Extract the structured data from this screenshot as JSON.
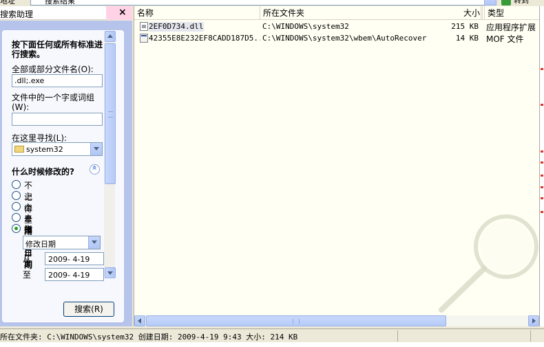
{
  "topbar": {
    "address_label": "地址",
    "address_value": "搜索结果",
    "go_label": "转到"
  },
  "left": {
    "pane_title": "搜索助理",
    "close_glyph": "×",
    "heading": "按下面任何或所有标准进行搜索。",
    "filename_label": "全部或部分文件名(O):",
    "filename_value": ".dll;.exe",
    "text_label": "文件中的一个字或词组(W):",
    "text_value": "",
    "lookin_label": "在这里寻找(L):",
    "lookin_value": "system32",
    "when_title": "什么时候修改的?",
    "radio_options": [
      {
        "label": "不记得",
        "checked": false
      },
      {
        "label": "上个星期内",
        "checked": false
      },
      {
        "label": "上个月",
        "checked": false
      },
      {
        "label": "去年一年内",
        "checked": false
      },
      {
        "label": "指定日期",
        "checked": true
      }
    ],
    "date_type_value": "修改日期",
    "from_label": "从",
    "from_value": "2009- 4-19",
    "to_label": "至",
    "to_value": "2009- 4-19",
    "search_button": "搜索(R)"
  },
  "results": {
    "columns": [
      "名称",
      "所在文件夹",
      "大小",
      "类型"
    ],
    "rows": [
      {
        "name": "2EF0D734.dll",
        "folder": "C:\\WINDOWS\\system32",
        "size": "215 KB",
        "type": "应用程序扩展",
        "icon": "dll-file-icon"
      },
      {
        "name": "42355E8E232EF8CADD187D5...",
        "folder": "C:\\WINDOWS\\system32\\wbem\\AutoRecover",
        "size": "14 KB",
        "type": "MOF 文件",
        "icon": "mof-file-icon"
      }
    ]
  },
  "status": {
    "text": "所在文件夹: C:\\WINDOWS\\system32 创建日期: 2009-4-19 9:43 大小: 214 KB"
  },
  "colors": {
    "pane_blue": "#b6c4ec",
    "results_bg": "#fffff3",
    "selected_row": "#e4e6ee",
    "radio_checked": "#21a121"
  }
}
